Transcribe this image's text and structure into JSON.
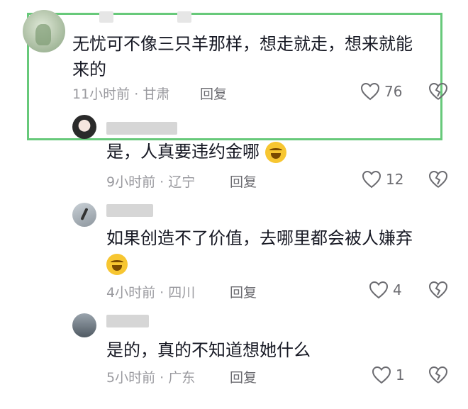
{
  "comments": [
    {
      "text_lines": [
        "无忧可不像三只羊那样，想走就走，想来就能",
        "来的"
      ],
      "time": "11小时前",
      "location": "甘肃",
      "reply_label": "回复",
      "likes": "76"
    },
    {
      "text": "是，人真要违约金哪",
      "emoji": "cry-laugh-emoji",
      "time": "9小时前",
      "location": "辽宁",
      "reply_label": "回复",
      "likes": "12"
    },
    {
      "text": "如果创造不了价值，去哪里都会被人嫌弃",
      "emoji": "cry-laugh-emoji",
      "time": "4小时前",
      "location": "四川",
      "reply_label": "回复",
      "likes": "4"
    },
    {
      "text": "是的，真的不知道想她什么",
      "time": "5小时前",
      "location": "广东",
      "reply_label": "回复",
      "likes": "1"
    }
  ],
  "separator": "·",
  "colors": {
    "highlight": "#67c97a",
    "text": "#161823",
    "meta": "#9a9a9f"
  }
}
